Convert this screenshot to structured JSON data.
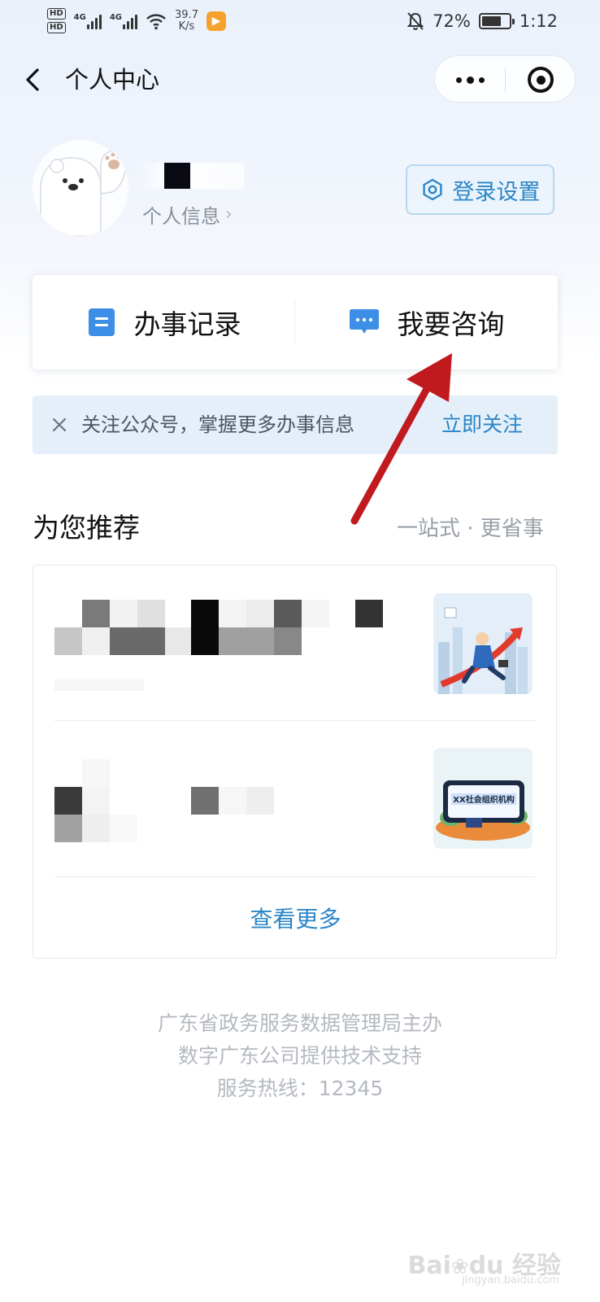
{
  "status_bar": {
    "hd1": "HD",
    "hd2": "HD",
    "net1": "4G",
    "net2": "4G",
    "speed_value": "39.7",
    "speed_unit": "K/s",
    "battery_percent": "72%",
    "battery_level": 0.72,
    "time": "1:12"
  },
  "nav": {
    "title": "个人中心"
  },
  "profile": {
    "link_label": "个人信息",
    "login_settings_label": "登录设置"
  },
  "actions": {
    "records_label": "办事记录",
    "consult_label": "我要咨询"
  },
  "banner": {
    "text": "关注公众号，掌握更多办事信息",
    "follow_label": "立即关注"
  },
  "recommend": {
    "title": "为您推荐",
    "subtitle": "一站式 · 更省事",
    "thumb2_caption": "XX社会组织机构",
    "view_more_label": "查看更多"
  },
  "footer": {
    "line1": "广东省政务服务数据管理局主办",
    "line2": "数字广东公司提供技术支持",
    "line3": "服务热线：12345"
  },
  "watermark": {
    "text": "Bai",
    "text2": "du",
    "text3": "经验",
    "sub": "jingyan.baidu.com"
  },
  "colors": {
    "accent": "#2b86c8",
    "arrow": "#c0191e",
    "icon_blue": "#3d8ee6"
  }
}
